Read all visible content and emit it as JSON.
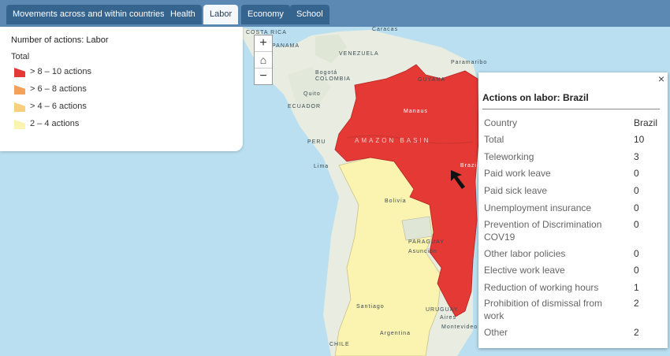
{
  "tabs": [
    {
      "label": "Movements across and within countries",
      "active": false
    },
    {
      "label": "Health",
      "active": false
    },
    {
      "label": "Labor",
      "active": true
    },
    {
      "label": "Economy",
      "active": false
    },
    {
      "label": "School",
      "active": false
    }
  ],
  "legend": {
    "title": "Number of actions: Labor",
    "subtitle": "Total",
    "items": [
      {
        "label": "> 8 – 10 actions",
        "color": "#e53935"
      },
      {
        "label": "> 6 – 8 actions",
        "color": "#f4a259"
      },
      {
        "label": "> 4 – 6 actions",
        "color": "#f7cf7f"
      },
      {
        "label": "2 – 4 actions",
        "color": "#fbf3b0"
      }
    ]
  },
  "zoom": {
    "in": "+",
    "home": "⌂",
    "out": "−"
  },
  "popup": {
    "close": "×",
    "title": "Actions on labor: Brazil",
    "rows": [
      {
        "key": "Country",
        "value": "Brazil"
      },
      {
        "key": "Total",
        "value": "10"
      },
      {
        "key": "Teleworking",
        "value": "3"
      },
      {
        "key": "Paid work leave",
        "value": "0"
      },
      {
        "key": "Paid sick leave",
        "value": "0"
      },
      {
        "key": "Unemployment insurance",
        "value": "0"
      },
      {
        "key": "Prevention of Discrimination COV19",
        "value": "0"
      },
      {
        "key": "Other labor policies",
        "value": "0"
      },
      {
        "key": "Elective work leave",
        "value": "0"
      },
      {
        "key": "Reduction of working hours",
        "value": "1"
      },
      {
        "key": "Prohibition of dismissal from work",
        "value": "2"
      },
      {
        "key": "Other",
        "value": "2"
      }
    ]
  },
  "map_labels": {
    "costa_rica": "COSTA RICA",
    "panama": "PANAMA",
    "caracas": "Caracas",
    "venezuela": "VENEZUELA",
    "bogota": "Bogotá",
    "colombia": "COLOMBIA",
    "paramaribo": "Paramaribo",
    "guyana": "GUYANA",
    "quito": "Quito",
    "ecuador": "ECUADOR",
    "amazon": "AMAZON BASIN",
    "peru": "PERU",
    "lima": "Lima",
    "brazil": "Brazil",
    "bolivia": "Bolivia",
    "paraguay": "PARAGUAY",
    "asuncion": "Asunción",
    "uruguay": "URUGUAY",
    "aires": "Aires",
    "montevideo": "Montevideo",
    "santiago": "Santiago",
    "argentina": "Argentina",
    "chile": "CHILE",
    "manaus": "Manaus"
  },
  "colors": {
    "ocean": "#b9dff0",
    "land": "#e9ece1",
    "high": "#e53935",
    "low": "#fbf3b0"
  }
}
